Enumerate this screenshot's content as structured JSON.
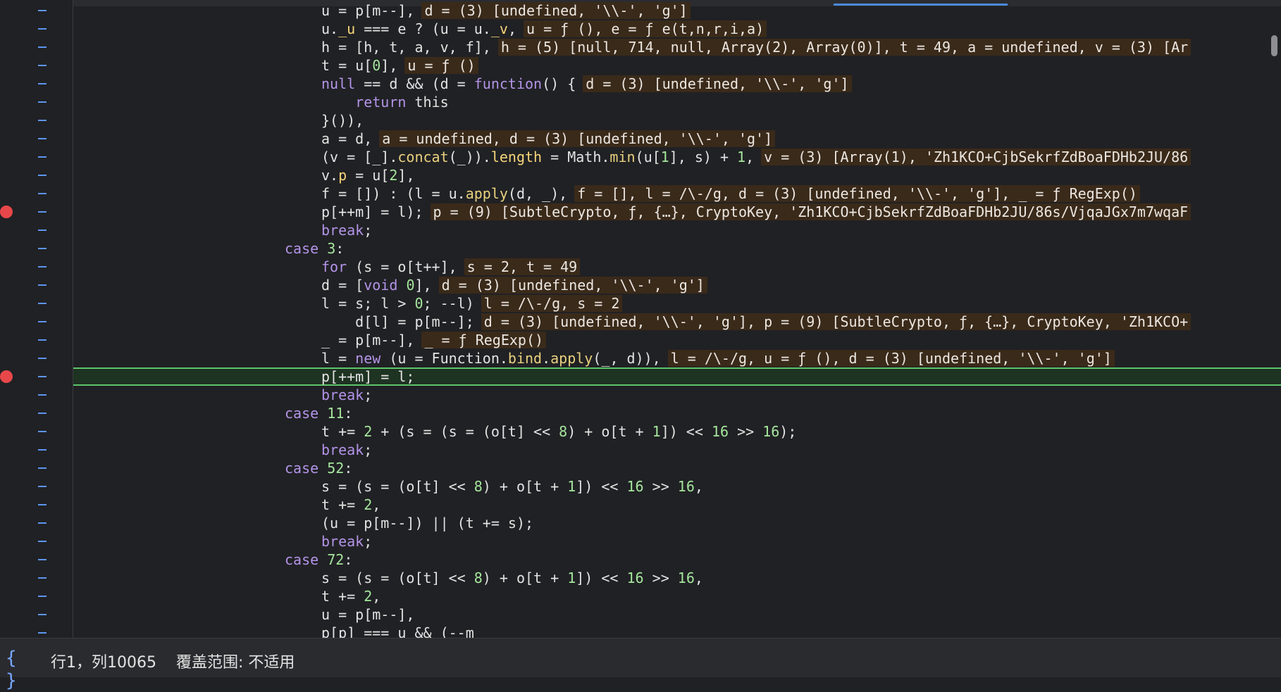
{
  "status": {
    "braces_icon": "{ }",
    "position": "行1，列10065",
    "coverage": "覆盖范围: 不适用"
  },
  "colors": {
    "breakpoint": "#e8474a",
    "current_line_border": "#5ec46b",
    "gutter_dash": "#5d95f0",
    "inline_value_bg": "#3a2a1a"
  },
  "lines": [
    {
      "code": "u = p[m--],",
      "value": "d = (3) [undefined, '\\\\-', 'g']"
    },
    {
      "code": "u._u === e ? (u = u._v,",
      "value": "u = ƒ (), e = ƒ e(t,n,r,i,a)"
    },
    {
      "code": "h = [h, t, a, v, f],",
      "value": "h = (5) [null, 714, null, Array(2), Array(0)], t = 49, a = undefined, v = (3) [Ar"
    },
    {
      "code": "t = u[0],",
      "value": "u = ƒ ()"
    },
    {
      "code": "null == d && (d = function() {",
      "value": "d = (3) [undefined, '\\\\-', 'g']"
    },
    {
      "code": "    return this",
      "value": ""
    },
    {
      "code": "}()),",
      "value": ""
    },
    {
      "code": "a = d,",
      "value": "a = undefined, d = (3) [undefined, '\\\\-', 'g']"
    },
    {
      "code": "(v = [_].concat(_)).length = Math.min(u[1], s) + 1,",
      "value": "v = (3) [Array(1), 'Zh1KCO+CjbSekrfZdBoaFDHb2JU/86"
    },
    {
      "code": "v.p = u[2],",
      "value": ""
    },
    {
      "code": "f = []) : (l = u.apply(d, _),",
      "value": "f = [], l = /\\-/g, d = (3) [undefined, '\\\\-', 'g'], _ = ƒ RegExp()"
    },
    {
      "code": "p[++m] = l);",
      "value": "p = (9) [SubtleCrypto, ƒ, {…}, CryptoKey, 'Zh1KCO+CjbSekrfZdBoaFDHb2JU/86s/VjqaJGx7m7wqaF"
    },
    {
      "code": "break;",
      "value": ""
    },
    {
      "code": "case 3:",
      "value": ""
    },
    {
      "code": "for (s = o[t++],",
      "value": "s = 2, t = 49"
    },
    {
      "code": "d = [void 0],",
      "value": "d = (3) [undefined, '\\\\-', 'g']"
    },
    {
      "code": "l = s; l > 0; --l)",
      "value": "l = /\\-/g, s = 2"
    },
    {
      "code": "    d[l] = p[m--];",
      "value": "d = (3) [undefined, '\\\\-', 'g'], p = (9) [SubtleCrypto, ƒ, {…}, CryptoKey, 'Zh1KCO+"
    },
    {
      "code": "_ = p[m--],",
      "value": "_ = ƒ RegExp()"
    },
    {
      "code": "l = new (u = Function.bind.apply(_, d)),",
      "value": "l = /\\-/g, u = ƒ (), d = (3) [undefined, '\\\\-', 'g']"
    },
    {
      "code": "p[++m] = l;",
      "value": ""
    },
    {
      "code": "break;",
      "value": ""
    },
    {
      "code": "case 11:",
      "value": ""
    },
    {
      "code": "t += 2 + (s = (s = (o[t] << 8) + o[t + 1]) << 16 >> 16);",
      "value": ""
    },
    {
      "code": "break;",
      "value": ""
    },
    {
      "code": "case 52:",
      "value": ""
    },
    {
      "code": "s = (s = (o[t] << 8) + o[t + 1]) << 16 >> 16,",
      "value": ""
    },
    {
      "code": "t += 2,",
      "value": ""
    },
    {
      "code": "(u = p[m--]) || (t += s);",
      "value": ""
    },
    {
      "code": "break;",
      "value": ""
    },
    {
      "code": "case 72:",
      "value": ""
    },
    {
      "code": "s = (s = (o[t] << 8) + o[t + 1]) << 16 >> 16,",
      "value": ""
    },
    {
      "code": "t += 2,",
      "value": ""
    },
    {
      "code": "u = p[m--],",
      "value": ""
    },
    {
      "code": "p[p] === u && (--m",
      "value": ""
    }
  ],
  "breakpoints": [
    11,
    20
  ],
  "current_line": 20
}
